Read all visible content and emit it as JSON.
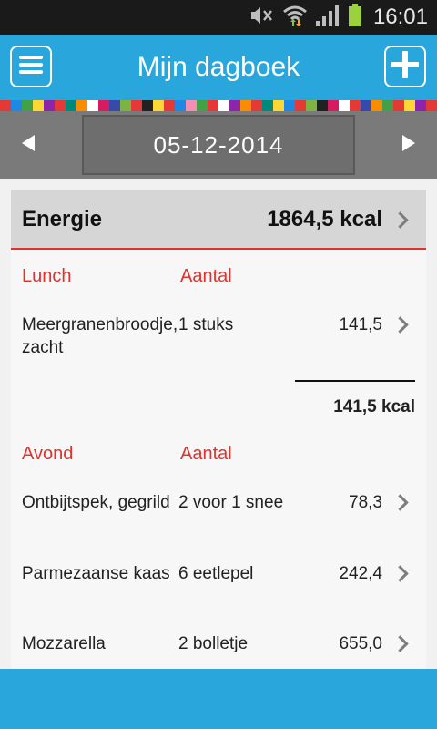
{
  "status_bar": {
    "time": "16:01",
    "icons": [
      "mute-icon",
      "wifi-icon",
      "signal-icon",
      "battery-icon"
    ]
  },
  "app_bar": {
    "title": "Mijn dagboek",
    "menu_icon": "menu-icon",
    "add_icon": "plus-icon",
    "color": "#29a6dc"
  },
  "date_nav": {
    "date": "05-12-2014",
    "prev_icon": "arrow-left-icon",
    "next_icon": "arrow-right-icon"
  },
  "energy": {
    "label": "Energie",
    "value": "1864,5 kcal"
  },
  "sections": [
    {
      "name": "Lunch",
      "qty_header": "Aantal",
      "items": [
        {
          "food": "Meergranenbroodje, zacht",
          "amount": "1 stuks",
          "kcal": "141,5"
        }
      ],
      "subtotal": "141,5 kcal"
    },
    {
      "name": "Avond",
      "qty_header": "Aantal",
      "items": [
        {
          "food": "Ontbijtspek, gegrild",
          "amount": "2 voor 1 snee",
          "kcal": "78,3"
        },
        {
          "food": "Parmezaanse kaas",
          "amount": "6 eetlepel",
          "kcal": "242,4"
        },
        {
          "food": "Mozzarella",
          "amount": "2 bolletje",
          "kcal": "655,0"
        }
      ]
    }
  ],
  "colors": {
    "accent_red": "#e0322f",
    "header_blue": "#29a6dc"
  }
}
